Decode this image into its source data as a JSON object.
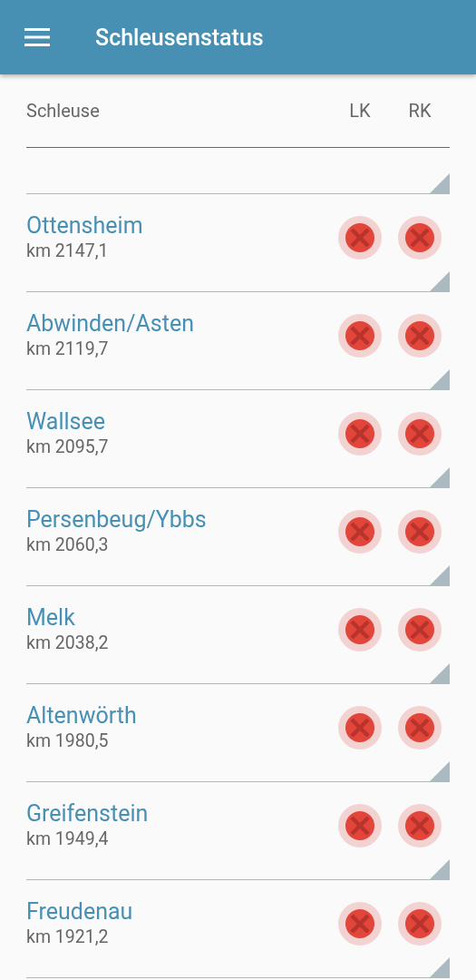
{
  "app_bar": {
    "title": "Schleusenstatus"
  },
  "table": {
    "columns": [
      "Schleuse",
      "LK",
      "RK"
    ],
    "rows": [
      {
        "name": "Ottensheim",
        "km": "km 2147,1",
        "lk_closed": true,
        "rk_closed": true
      },
      {
        "name": "Abwinden/Asten",
        "km": "km 2119,7",
        "lk_closed": true,
        "rk_closed": true
      },
      {
        "name": "Wallsee",
        "km": "km 2095,7",
        "lk_closed": true,
        "rk_closed": true
      },
      {
        "name": "Persenbeug/Ybbs",
        "km": "km 2060,3",
        "lk_closed": true,
        "rk_closed": true
      },
      {
        "name": "Melk",
        "km": "km 2038,2",
        "lk_closed": true,
        "rk_closed": true
      },
      {
        "name": "Altenwörth",
        "km": "km 1980,5",
        "lk_closed": true,
        "rk_closed": true
      },
      {
        "name": "Greifenstein",
        "km": "km 1949,4",
        "lk_closed": true,
        "rk_closed": true
      },
      {
        "name": "Freudenau",
        "km": "km 1921,2",
        "lk_closed": true,
        "rk_closed": true
      }
    ]
  }
}
